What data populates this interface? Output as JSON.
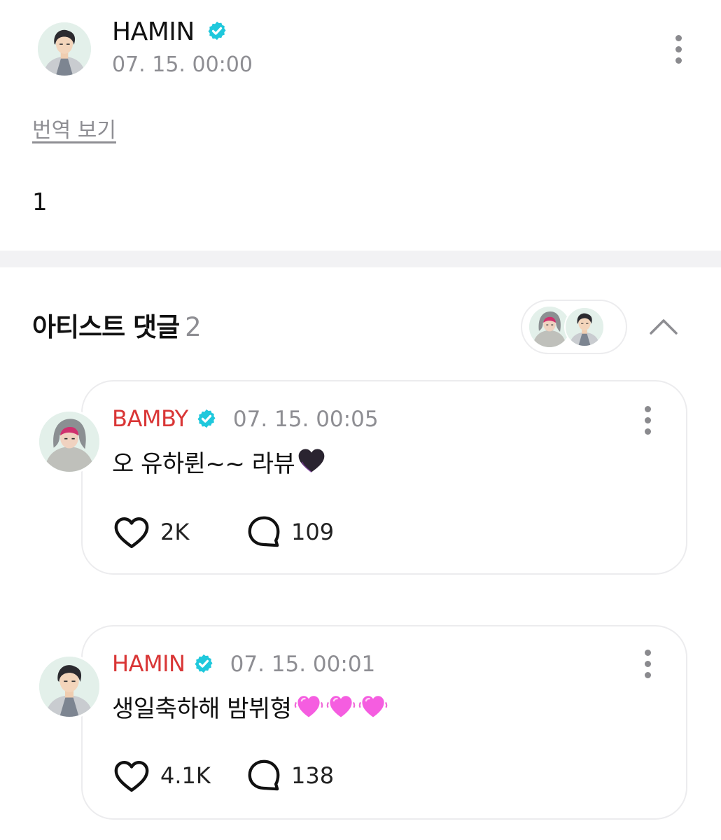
{
  "post": {
    "author": "HAMIN",
    "timestamp": "07. 15. 00:00",
    "translate_label": "번역 보기",
    "body": "1"
  },
  "artist_comments": {
    "title": "아티스트 댓글",
    "count": "2"
  },
  "comments": [
    {
      "author": "BAMBY",
      "timestamp": "07. 15. 00:05",
      "text": "오 유하륀~~ 라뷰",
      "emoji": "black-heart",
      "likes": "2K",
      "replies": "109"
    },
    {
      "author": "HAMIN",
      "timestamp": "07. 15. 00:01",
      "text": "생일축하해 밤뷔형",
      "emoji": "pink-heart x3",
      "likes": "4.1K",
      "replies": "138"
    }
  ],
  "icons": {
    "verified": "verified-badge-icon",
    "more": "more-vertical-icon",
    "like": "heart-outline-icon",
    "reply": "speech-bubble-icon",
    "collapse": "chevron-up-icon"
  },
  "colors": {
    "accent_name": "#d93636",
    "verified": "#1fc8dc",
    "muted": "#8e8e93"
  }
}
